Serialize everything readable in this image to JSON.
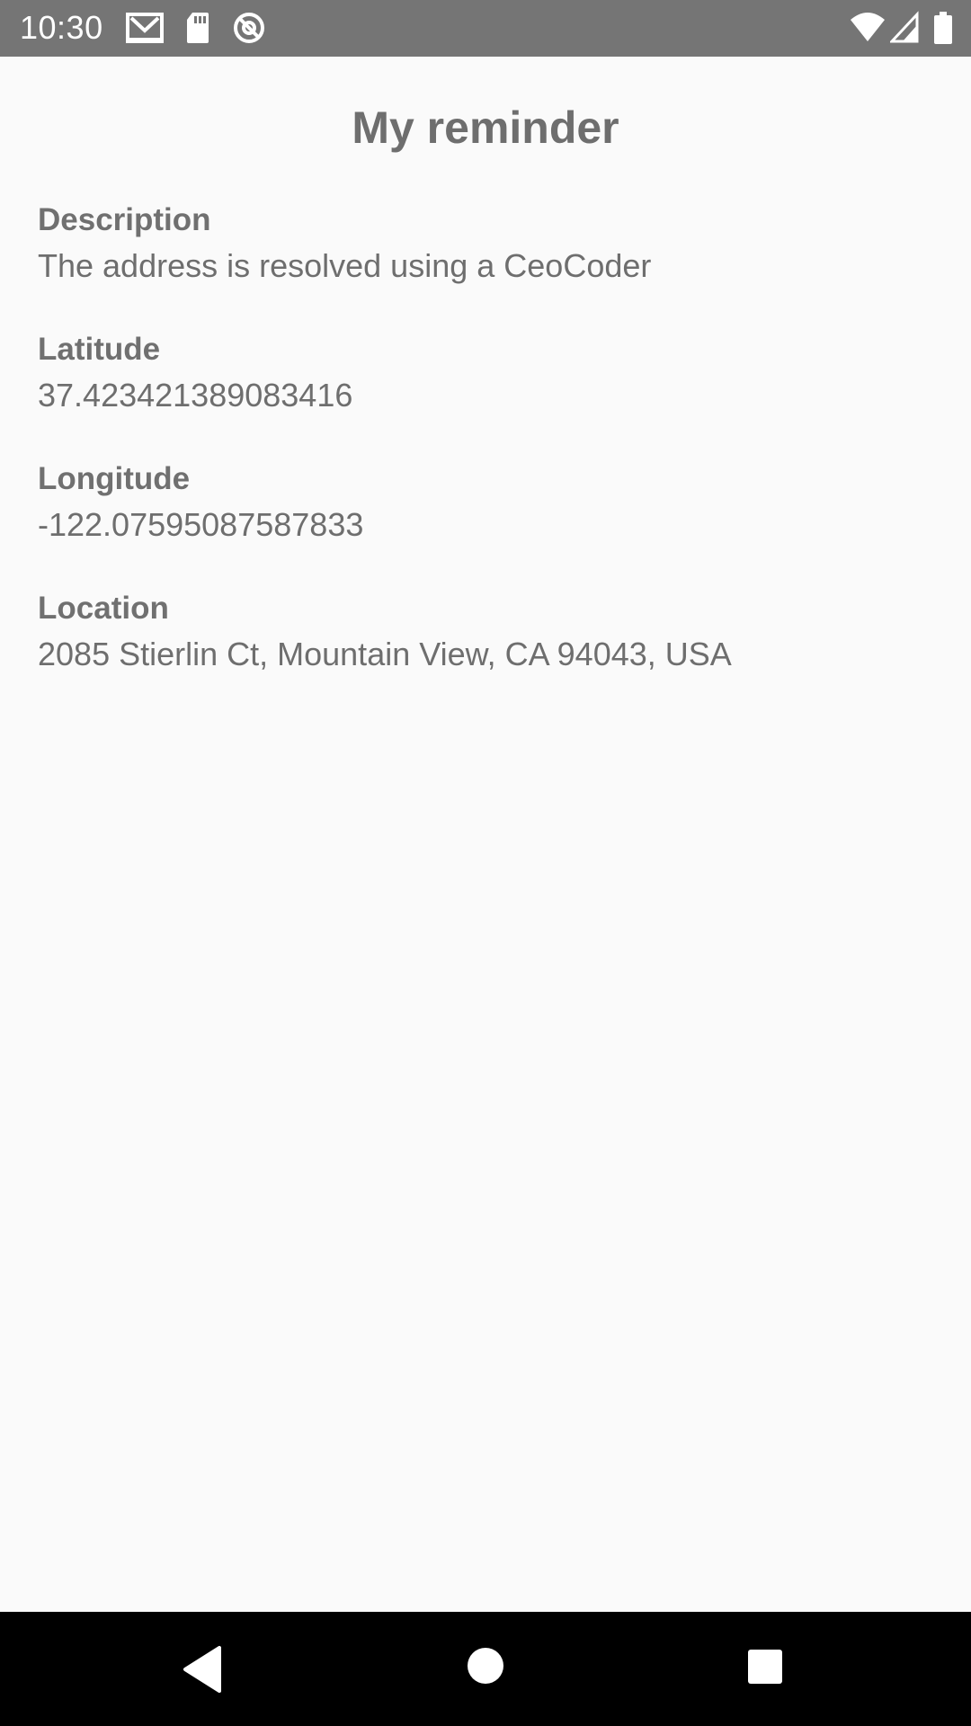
{
  "status_bar": {
    "time": "10:30",
    "icons_left": [
      "gmail-icon",
      "sd-card-icon",
      "no-disturb-icon"
    ],
    "icons_right": [
      "wifi-icon",
      "cell-signal-icon",
      "battery-icon"
    ],
    "background": "#757575"
  },
  "screen": {
    "title": "My reminder",
    "fields": [
      {
        "label": "Description",
        "value": "The address is resolved using a CeoCoder"
      },
      {
        "label": "Latitude",
        "value": "37.423421389083416"
      },
      {
        "label": "Longitude",
        "value": "-122.07595087587833"
      },
      {
        "label": "Location",
        "value": "2085 Stierlin Ct, Mountain View, CA 94043, USA"
      }
    ]
  },
  "nav_bar": {
    "buttons": [
      "back-icon",
      "home-icon",
      "recents-icon"
    ],
    "background": "#000000"
  }
}
